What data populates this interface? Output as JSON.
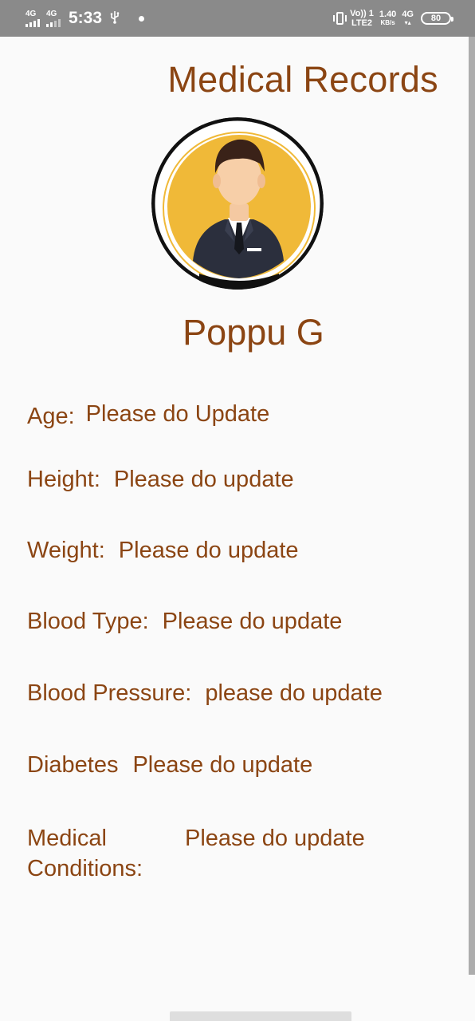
{
  "status_bar": {
    "sim1_label": "4G",
    "sim2_label": "4G",
    "time": "5:33",
    "volte_top": "Vo)) 1",
    "volte_bottom": "LTE2",
    "speed_value": "1.40",
    "speed_unit": "KB/s",
    "net_type": "4G",
    "battery": "80",
    "icons": [
      "signal-icon",
      "signal-icon",
      "usb-icon",
      "notification-dot-icon",
      "vibrate-icon",
      "battery-icon"
    ]
  },
  "header": {
    "title": "Medical Records"
  },
  "profile": {
    "avatar": "businessman-avatar",
    "name": "Poppu G"
  },
  "records": {
    "age": {
      "label": "Age:",
      "value": "Please do Update"
    },
    "height": {
      "label": "Height:",
      "value": "Please do update"
    },
    "weight": {
      "label": "Weight:",
      "value": "Please do update"
    },
    "blood_type": {
      "label": "Blood Type:",
      "value": "Please do update"
    },
    "blood_pressure": {
      "label": "Blood Pressure:",
      "value": "please do update"
    },
    "diabetes": {
      "label": "Diabetes",
      "value": "Please do update"
    },
    "medical_conditions": {
      "label_line1": "Medical",
      "label_line2": "Conditions:",
      "value": "Please do update"
    }
  },
  "colors": {
    "text_brown": "#8b4513",
    "status_bar": "#8a8a8a",
    "avatar_bg": "#f0b938",
    "background": "#fafafa"
  }
}
